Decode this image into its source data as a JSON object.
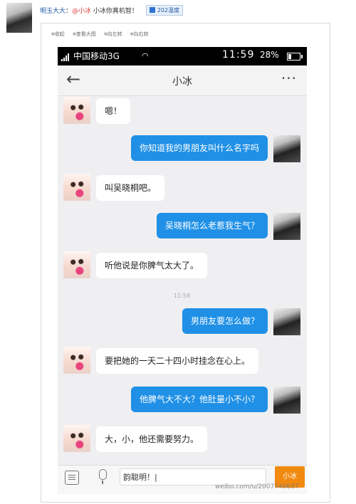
{
  "post": {
    "author": "明玉大大",
    "mention": "@小冰",
    "text": " 小冰你真机智！",
    "badge": "202温度"
  },
  "toolbar": {
    "items": [
      "收起",
      "查看大图",
      "向左转",
      "向右转"
    ]
  },
  "statusbar": {
    "carrier": "中国移动3G",
    "time": "11:59",
    "battery": "28%"
  },
  "chat": {
    "title": "小冰",
    "back_glyph": "←",
    "more_glyph": "···",
    "timestamp": "11:58",
    "messages": [
      {
        "side": "left",
        "text": "嗯！"
      },
      {
        "side": "right",
        "text": "你知道我的男朋友叫什么名字吗"
      },
      {
        "side": "left",
        "text": "叫吴晓桐吧。"
      },
      {
        "side": "right",
        "text": "吴晓桐怎么老惹我生气？"
      },
      {
        "side": "left",
        "text": "听他说是你脾气太大了。"
      },
      {
        "side": "right",
        "text": "男朋友要怎么做？"
      },
      {
        "side": "left",
        "text": "要把她的一天二十四小时挂念在心上。"
      },
      {
        "side": "right",
        "text": "他脾气大不大？他肚量小不小？"
      },
      {
        "side": "left",
        "text": "大，小，他还需要努力。"
      }
    ]
  },
  "input": {
    "value": "韵聪明！|",
    "send_label": "小冰"
  },
  "watermark": "weibo.com/u/2007740637"
}
